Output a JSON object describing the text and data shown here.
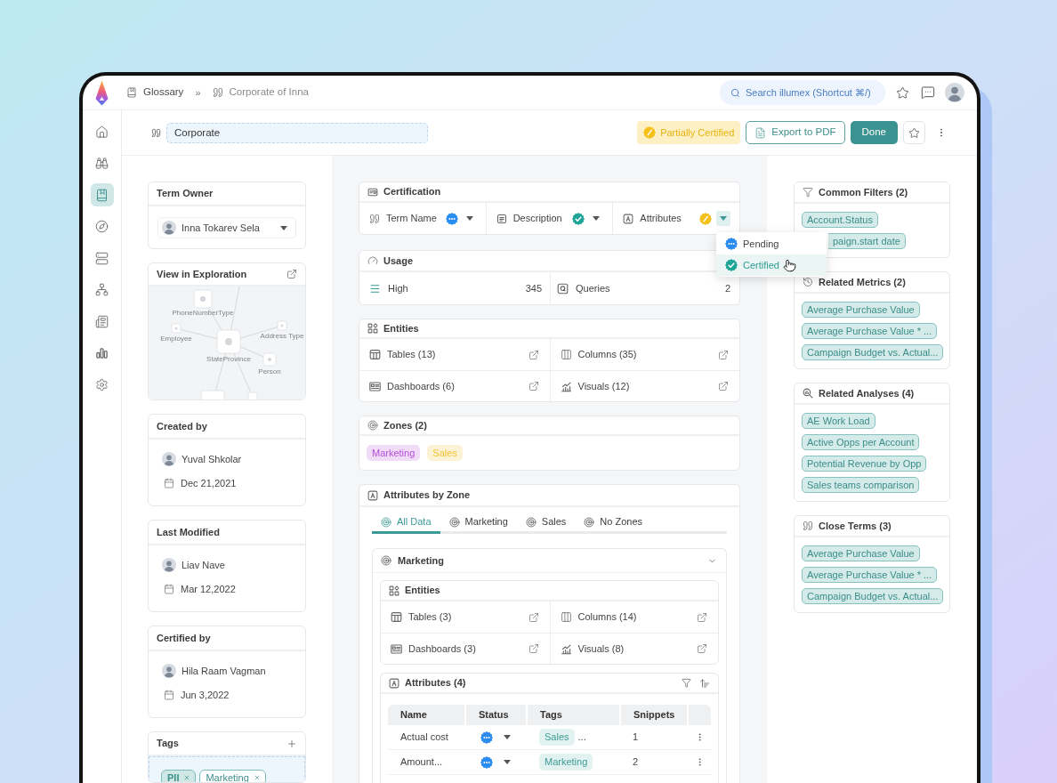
{
  "topbar": {
    "breadcrumb": [
      {
        "label": "Glossary",
        "kind": "book"
      },
      {
        "label": "Corporate of Inna",
        "kind": "quote"
      }
    ],
    "separator": "»",
    "search": {
      "placeholder": "Search illumex (Shortcut ⌘/)"
    }
  },
  "nav": [
    {
      "kind": "home",
      "selected": false
    },
    {
      "kind": "binoculars",
      "selected": false
    },
    {
      "kind": "glossary",
      "selected": true
    },
    {
      "kind": "compass",
      "selected": false
    },
    {
      "kind": "server",
      "selected": false
    },
    {
      "kind": "network",
      "selected": false
    },
    {
      "kind": "report",
      "selected": false
    },
    {
      "kind": "chart",
      "selected": false
    },
    {
      "kind": "settings",
      "selected": false
    }
  ],
  "term": {
    "value": "Corporate",
    "status_badge": {
      "label": "Partially Certified",
      "kind": "partial"
    },
    "buttons": [
      {
        "label": "Export to PDF",
        "kind": "outline"
      },
      {
        "label": "Done",
        "kind": "primary"
      }
    ]
  },
  "left": {
    "term_owner": {
      "title": "Term Owner",
      "name": "Inna Tokarev Sela"
    },
    "exploration": {
      "title": "View in Exploration",
      "node_labels": [
        "PhoneNumberType",
        "Employee",
        "StateProvince",
        "Address Type",
        "Person"
      ]
    },
    "people": [
      {
        "title": "Created by",
        "name": "Yuval Shkolar",
        "date": "Dec 21,2021"
      },
      {
        "title": "Last Modified",
        "name": "Liav Nave",
        "date": "Mar 12,2022"
      },
      {
        "title": "Certified by",
        "name": "Hila Raam Vagman",
        "date": "Jun 3,2022"
      }
    ],
    "tags": {
      "title": "Tags",
      "items": [
        {
          "label": "PII",
          "selected": true
        },
        {
          "label": "Marketing",
          "selected": false
        }
      ]
    }
  },
  "certification": {
    "title": "Certification",
    "items": [
      {
        "label": "Term Name",
        "kind": "quote",
        "badge": {
          "kind": "pending"
        },
        "expanded": false
      },
      {
        "label": "Description",
        "kind": "text",
        "badge": {
          "kind": "certified"
        },
        "expanded": false
      },
      {
        "label": "Attributes",
        "kind": "attribute",
        "badge": {
          "kind": "partial"
        },
        "expanded": true
      }
    ],
    "menu": [
      {
        "label": "Pending",
        "kind": "pending",
        "selected": false
      },
      {
        "label": "Certified",
        "kind": "certified",
        "selected": true
      }
    ]
  },
  "usage": {
    "title": "Usage",
    "items": [
      {
        "label": "High",
        "value": "345",
        "kind": "level"
      },
      {
        "label": "Queries",
        "value": "2",
        "kind": "queries"
      }
    ]
  },
  "entities": {
    "title": "Entities",
    "items": [
      {
        "label": "Tables (13)",
        "kind": "table"
      },
      {
        "label": "Columns (35)",
        "kind": "columns"
      },
      {
        "label": "Dashboards (6)",
        "kind": "dashboard"
      },
      {
        "label": "Visuals (12)",
        "kind": "visual"
      }
    ]
  },
  "zones": {
    "title": "Zones (2)",
    "items": [
      {
        "label": "Marketing",
        "color": "#b54fd8"
      },
      {
        "label": "Sales",
        "color": "#f1c232"
      }
    ]
  },
  "attributes_by_zone": {
    "title": "Attributes by Zone",
    "tabs": [
      {
        "label": "All Data",
        "selected": true
      },
      {
        "label": "Marketing",
        "selected": false
      },
      {
        "label": "Sales",
        "selected": false
      },
      {
        "label": "No Zones",
        "selected": false
      }
    ],
    "section": {
      "title": "Marketing",
      "expanded": true,
      "entities": {
        "title": "Entities",
        "items": [
          {
            "label": "Tables (3)",
            "kind": "table"
          },
          {
            "label": "Columns (14)",
            "kind": "columns"
          },
          {
            "label": "Dashboards (3)",
            "kind": "dashboard"
          },
          {
            "label": "Visuals (8)",
            "kind": "visual"
          }
        ]
      },
      "attributes": {
        "title": "Attributes (4)",
        "columns": [
          "Name",
          "Status",
          "Tags",
          "Snippets"
        ],
        "rows": [
          {
            "name": "Actual cost",
            "badge": {
              "kind": "pending"
            },
            "tags": [
              "Sales"
            ],
            "more": "...",
            "snippets": "1"
          },
          {
            "name": "Amount...",
            "badge": {
              "kind": "pending"
            },
            "tags": [
              "Marketing"
            ],
            "snippets": "2"
          }
        ]
      }
    }
  },
  "right": [
    {
      "title": "Common Filters (2)",
      "kind": "filter",
      "chips": [
        {
          "label": "Account.Status",
          "clipped": false
        },
        {
          "label": "paign.start date",
          "clipped": true
        }
      ]
    },
    {
      "title": "Related Metrics (2)",
      "kind": "metric",
      "chips": [
        {
          "label": "Average Purchase Value"
        },
        {
          "label": "Average Purchase Value * ..."
        },
        {
          "label": "Campaign Budget vs. Actual..."
        }
      ]
    },
    {
      "title": "Related Analyses (4)",
      "kind": "analysis",
      "chips": [
        {
          "label": "AE Work Load"
        },
        {
          "label": "Active Opps per Account"
        },
        {
          "label": "Potential Revenue by Opp"
        },
        {
          "label": "Sales teams comparison"
        }
      ]
    },
    {
      "title": "Close Terms (3)",
      "kind": "quote",
      "chips": [
        {
          "label": "Average Purchase Value"
        },
        {
          "label": "Average Purchase Value * ..."
        },
        {
          "label": "Campaign Budget vs. Actual..."
        }
      ]
    }
  ]
}
